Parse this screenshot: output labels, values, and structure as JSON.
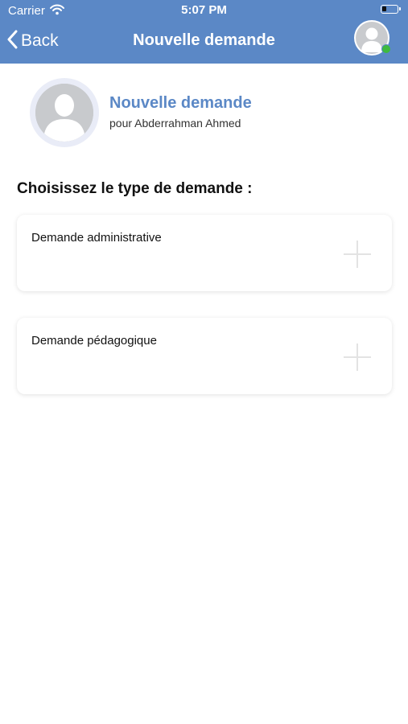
{
  "status_bar": {
    "carrier": "Carrier",
    "time": "5:07 PM"
  },
  "nav": {
    "back_label": "Back",
    "title": "Nouvelle demande",
    "online_color": "#3fba3f"
  },
  "profile": {
    "title": "Nouvelle demande",
    "subtitle": "pour Abderrahman Ahmed"
  },
  "section": {
    "heading": "Choisissez le type de demande :"
  },
  "request_types": [
    {
      "label": "Demande administrative",
      "icon": "plus-icon"
    },
    {
      "label": "Demande pédagogique",
      "icon": "plus-icon"
    }
  ],
  "colors": {
    "accent": "#5b88c6",
    "background": "#ffffff"
  }
}
